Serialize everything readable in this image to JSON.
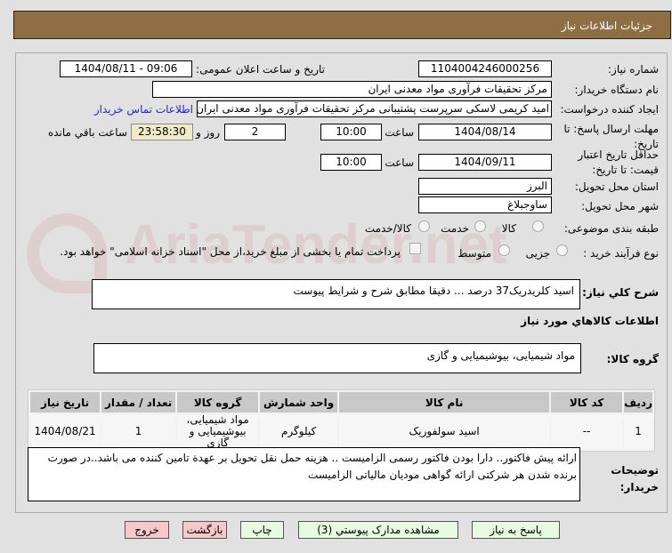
{
  "header": {
    "title": "جزئیات اطلاعات نیاز"
  },
  "watermark": "AriaTender.net",
  "fields": {
    "need_number_label": "شماره نیاز:",
    "need_number": "1104004246000256",
    "announce_label": "تاریخ و ساعت اعلان عمومی:",
    "announce_value": "1404/08/11 - 09:06",
    "buyer_label": "نام دستگاه خریدار:",
    "buyer": "مرکز تحقیقات فرآوری مواد معدنی ایران",
    "creator_label": "ایجاد کننده درخواست:",
    "creator": "امید کریمی لاسکی سرپرست پشتیبانی مرکز تحقیقات فرآوری مواد معدنی ایران",
    "contact_link": "اطلاعات تماس خریدار",
    "deadline_label": "مهلت ارسال پاسخ: تا تاریخ:",
    "deadline_date": "1404/08/14",
    "time_label": "ساعت",
    "deadline_time": "10:00",
    "days": "2",
    "days_label": "روز و",
    "remaining": "23:58:30",
    "remaining_label": "ساعت باقي مانده",
    "validity_label": "حداقل تاریخ اعتبار قیمت: تا تاریخ:",
    "validity_date": "1404/09/11",
    "validity_time": "10:00",
    "province_label": "استان محل تحویل:",
    "province": "البرز",
    "city_label": "شهر محل تحویل:",
    "city": "ساوجبلاغ",
    "category_label": "طبقه بندی موضوعی:",
    "category_options": [
      "کالا",
      "خدمت",
      "کالا/خدمت"
    ],
    "category_selected": "کالا",
    "process_label": "نوع فرآیند خرید :",
    "process_options": [
      "جزیی",
      "متوسط"
    ],
    "payment_note": "پرداخت تمام یا بخشی از مبلغ خرید،از محل \"اسناد خزانه اسلامی\" خواهد بود."
  },
  "description": {
    "label": "شرح کلي نياز:",
    "value": "اسید کلریدریک37 درصد ... دقیقا مطابق شرح و شرایط پیوست"
  },
  "goods_section": {
    "title": "اطلاعات کالاهاي مورد نياز",
    "group_label": "گروه کالا:",
    "group_value": "مواد شیمیایی، بیوشیمیایی و  گازی"
  },
  "table": {
    "headers": [
      "ردیف",
      "کد کالا",
      "نام کالا",
      "واحد شمارش",
      "گروه کالا",
      "تعداد / مقدار",
      "تاریخ نیاز"
    ],
    "rows": [
      [
        "1",
        "--",
        "اسید سولفوریک",
        "کیلوگرم",
        "مواد شیمیایی، بیوشیمیایی و گازی",
        "1",
        "1404/08/21"
      ]
    ]
  },
  "notes": {
    "label": "توضیحات خریدار:",
    "value": "ارائه پیش فاکتور.. دارا بودن فاکتور رسمی الزامیست .. هزینه حمل نقل تحویل بر عهدة تامین کننده می باشد..در صورت برنده شدن هر شرکتی ارائه گواهی مودیان مالیاتی الزامیست"
  },
  "buttons": {
    "reply": "پاسخ به نياز",
    "attachments": "مشاهده مدارک پیوستي (3)",
    "print": "چاپ",
    "back": "بازگشت",
    "exit": "خروج"
  }
}
